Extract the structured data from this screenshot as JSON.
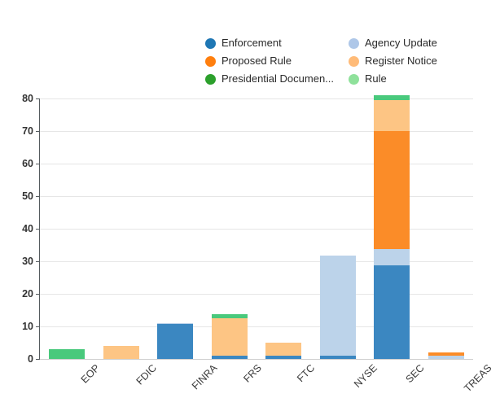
{
  "chart_data": {
    "type": "bar",
    "subtype": "stacked-bar",
    "title": "",
    "xlabel": "",
    "ylabel": "",
    "ylim": [
      0,
      80
    ],
    "yticks": [
      0,
      10,
      20,
      30,
      40,
      50,
      60,
      70,
      80
    ],
    "grid": true,
    "legend_position": "top-center",
    "categories": [
      "EOP",
      "FDIC",
      "FINRA",
      "FRS",
      "FTC",
      "NYSE",
      "SEC",
      "TREAS"
    ],
    "series": [
      {
        "name": "Enforcement",
        "color": "#3b87c1",
        "values": [
          0,
          0,
          10.7,
          1.0,
          1.0,
          1.1,
          28.7,
          0
        ]
      },
      {
        "name": "Agency Update",
        "color": "#bcd3ea",
        "values": [
          0,
          0,
          0.4,
          0,
          0,
          30.6,
          5.0,
          1.0
        ]
      },
      {
        "name": "Proposed Rule",
        "color": "#fb8c28",
        "values": [
          0,
          0,
          0,
          0,
          0,
          0,
          36.3,
          1.0
        ]
      },
      {
        "name": "Register Notice",
        "color": "#fdc584",
        "values": [
          0,
          4.0,
          0,
          11.4,
          4.0,
          0,
          9.5,
          0
        ]
      },
      {
        "name": "Presidential Documen...",
        "color": "#21a14b",
        "values": [
          0,
          0,
          0,
          0,
          0,
          0,
          0,
          0
        ]
      },
      {
        "name": "Rule",
        "color": "#49c97c",
        "values": [
          3.0,
          0,
          0,
          1.3,
          0,
          0,
          1.5,
          0
        ]
      }
    ],
    "totals": [
      3.0,
      4.0,
      11.1,
      13.7,
      5.0,
      31.7,
      81.0,
      2.0
    ]
  },
  "legend": {
    "items": [
      {
        "label": "Enforcement",
        "color": "#1f77b4"
      },
      {
        "label": "Agency Update",
        "color": "#aec7e8"
      },
      {
        "label": "Proposed Rule",
        "color": "#ff7f0e"
      },
      {
        "label": "Register Notice",
        "color": "#ffbb78"
      },
      {
        "label": "Presidential Documen...",
        "color": "#2ca02c"
      },
      {
        "label": "Rule",
        "color": "#8fe19b"
      }
    ]
  },
  "axes": {
    "y": {
      "ticks": [
        "0",
        "10",
        "20",
        "30",
        "40",
        "50",
        "60",
        "70",
        "80"
      ]
    },
    "x": {
      "ticks": [
        "EOP",
        "FDIC",
        "FINRA",
        "FRS",
        "FTC",
        "NYSE",
        "SEC",
        "TREAS"
      ]
    }
  }
}
